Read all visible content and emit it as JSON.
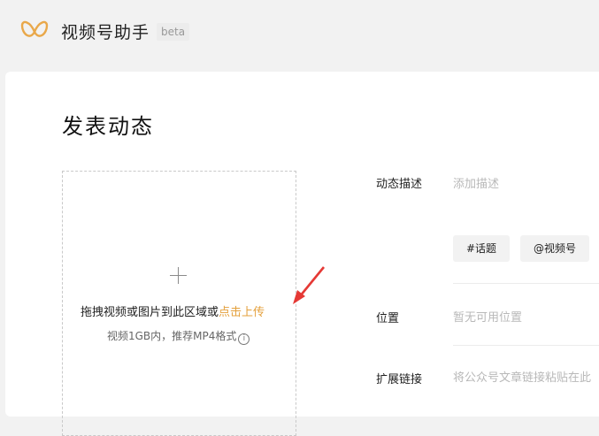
{
  "header": {
    "app_title": "视频号助手",
    "beta_badge": "beta"
  },
  "page": {
    "title": "发表动态"
  },
  "upload": {
    "prompt": "拖拽视频或图片到此区域或",
    "link_text": "点击上传",
    "hint": "视频1GB内，推荐MP4格式",
    "info_glyph": "i"
  },
  "form": {
    "description": {
      "label": "动态描述",
      "placeholder": "添加描述"
    },
    "topic_button": "#话题",
    "mention_button": "@视频号",
    "location": {
      "label": "位置",
      "placeholder": "暂无可用位置"
    },
    "extended_link": {
      "label": "扩展链接",
      "placeholder": "将公众号文章链接粘贴在此"
    }
  },
  "colors": {
    "accent": "#e4a03c",
    "arrow": "#e53935",
    "background": "#f2f2f2"
  }
}
